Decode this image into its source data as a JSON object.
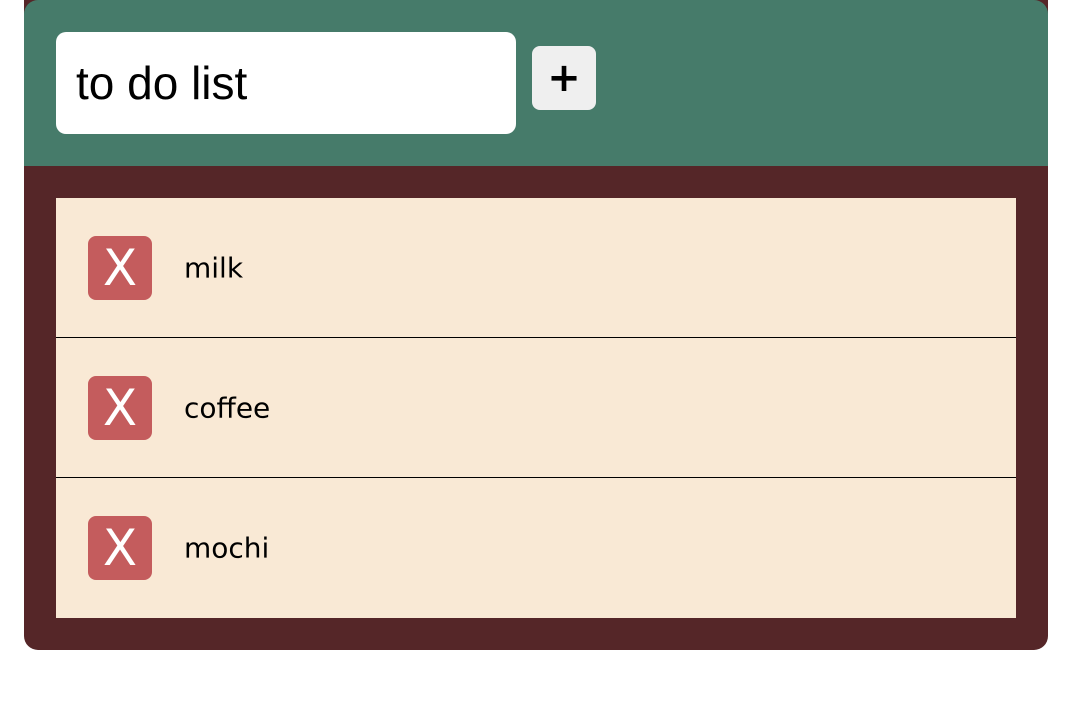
{
  "header": {
    "input_value": "to do list",
    "add_button_label": "+"
  },
  "todos": [
    {
      "label": "milk",
      "delete_label": "X"
    },
    {
      "label": "coffee",
      "delete_label": "X"
    },
    {
      "label": "mochi",
      "delete_label": "X"
    }
  ],
  "colors": {
    "header_bg": "#467b6a",
    "panel_bg": "#552628",
    "item_bg": "#f9e9d5",
    "delete_bg": "#c45c5d"
  }
}
